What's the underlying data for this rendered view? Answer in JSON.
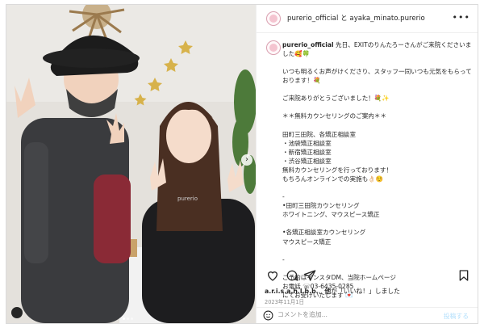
{
  "header": {
    "account": "purerio_official",
    "joiner": "と",
    "collaborator": "ayaka_minato.purerio",
    "more_icon": "ellipsis-icon"
  },
  "caption": {
    "username": "purerio_official",
    "text": "先日、EXITのりんたろーさんがご来院くださいました🥰🍀",
    "paragraphs": [
      "いつも明るくお声がけくださり、スタッフ一同いつも元気をもらっております！💐",
      "ご来院ありがとうございました！💐✨",
      "＊＊無料カウンセリングのご案内＊＊",
      "田町三田院、各矯正相談室\n・池袋矯正相談室\n・新宿矯正相談室\n・渋谷矯正相談室\n無料カウンセリングを行っております！\nもちろんオンラインでの実施も👌🏻☺️",
      "-",
      "•田町三田院カウンセリング\nホワイトニング、マウスピース矯正",
      "•各矯正相談室カウンセリング\nマウスピース矯正",
      "-",
      "ご予約はインスタDM、当院ホームページ\nお電話 ☏03-6435-0285\nにてお受けいたします 💌"
    ]
  },
  "actions": {
    "icons": [
      "heart-icon",
      "comment-icon",
      "share-icon",
      "bookmark-icon"
    ]
  },
  "likes": {
    "user": "a.r.i.s.a.h.l.b.b.",
    "connector": "、",
    "others": "他",
    "suffix": "が「いいね！」しました"
  },
  "date": "2023年11月1日",
  "comment": {
    "placeholder": "コメントを追加...",
    "post_label": "投稿する",
    "emoji_icon": "smiley-icon"
  },
  "carousel": {
    "count": 3,
    "active": 0
  },
  "colors": {
    "accent": "#0095f6",
    "post_disabled": "#b2dffc",
    "border": "#dbdbdb",
    "muted": "#8e8e8e"
  }
}
